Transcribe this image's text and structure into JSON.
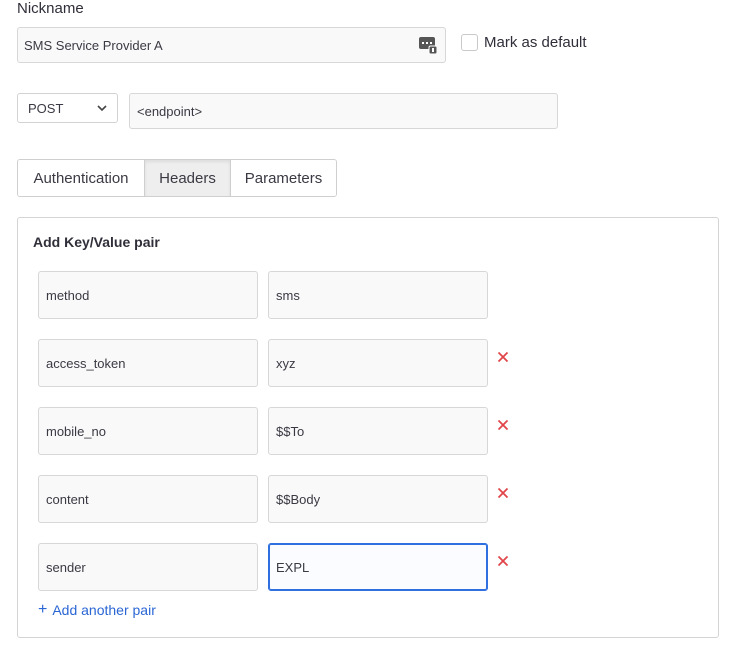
{
  "nickname": {
    "label": "Nickname",
    "value": "SMS Service Provider A",
    "field_icon": "password-manager-icon"
  },
  "default_checkbox": {
    "label": "Mark as default",
    "checked": false
  },
  "request": {
    "method": "POST",
    "endpoint_value": "<endpoint>"
  },
  "tabs": [
    {
      "label": "Authentication",
      "active": false
    },
    {
      "label": "Headers",
      "active": true
    },
    {
      "label": "Parameters",
      "active": false
    }
  ],
  "kv_panel": {
    "title": "Add Key/Value pair",
    "pairs": [
      {
        "key": "method",
        "value": "sms",
        "removable": false
      },
      {
        "key": "access_token",
        "value": "xyz",
        "removable": true
      },
      {
        "key": "mobile_no",
        "value": "$$To",
        "removable": true
      },
      {
        "key": "content",
        "value": "$$Body",
        "removable": true
      },
      {
        "key": "sender",
        "value": "EXPL",
        "removable": true,
        "focused": true
      }
    ],
    "add_label": "Add another pair"
  },
  "colors": {
    "accent": "#2a66d4",
    "remove": "#e0454a",
    "focus": "#2f6fe0"
  }
}
